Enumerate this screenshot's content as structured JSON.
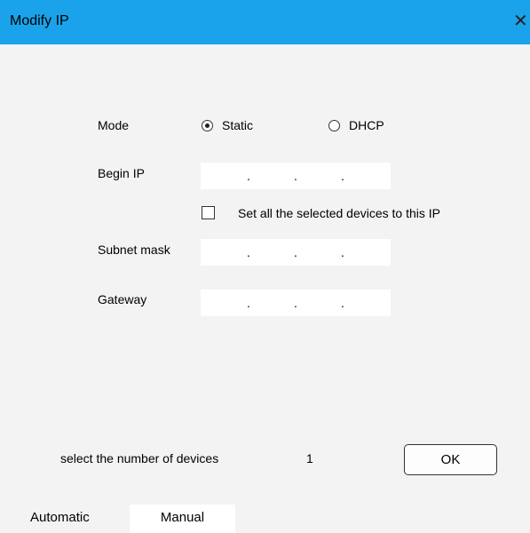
{
  "dialog": {
    "title": "Modify IP",
    "close_glyph": "✕"
  },
  "mode": {
    "label": "Mode",
    "options": [
      {
        "label": "Static",
        "selected": true
      },
      {
        "label": "DHCP",
        "selected": false
      }
    ]
  },
  "begin_ip": {
    "label": "Begin IP",
    "octets": [
      "",
      "",
      "",
      ""
    ]
  },
  "set_all": {
    "label": "Set all the selected devices to this IP",
    "checked": false
  },
  "subnet_mask": {
    "label": "Subnet mask",
    "octets": [
      "",
      "",
      "",
      ""
    ]
  },
  "gateway": {
    "label": "Gateway",
    "octets": [
      "",
      "",
      "",
      ""
    ]
  },
  "device_count": {
    "label": "select the number of devices",
    "value": "1"
  },
  "ok_button": {
    "label": "OK"
  },
  "tabs": [
    {
      "label": "Automatic",
      "active": false
    },
    {
      "label": "Manual",
      "active": true
    }
  ],
  "ip_separator": ".",
  "colors": {
    "titlebar": "#1aa3ea",
    "background": "#f3f3f3"
  }
}
